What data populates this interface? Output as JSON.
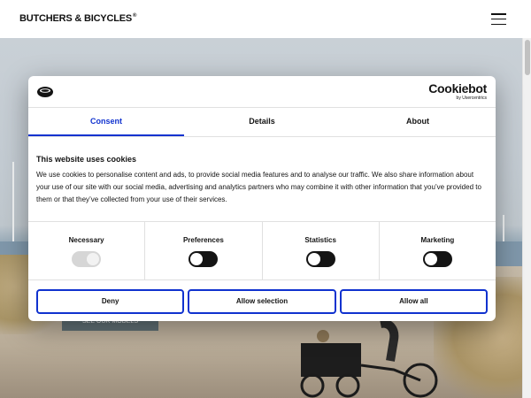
{
  "header": {
    "brand": "BUTCHERS & BICYCLES",
    "brand_mark": "®",
    "menu_icon": "hamburger-icon"
  },
  "hero": {
    "cta_label": "SEE OUR MODELS"
  },
  "cookie_dialog": {
    "logo_icon": "cookie-icon",
    "brand_name": "Cookiebot",
    "brand_sub": "by Usercentrics",
    "tabs": [
      {
        "label": "Consent",
        "active": true
      },
      {
        "label": "Details",
        "active": false
      },
      {
        "label": "About",
        "active": false
      }
    ],
    "heading": "This website uses cookies",
    "description": "We use cookies to personalise content and ads, to provide social media features and to analyse our traffic. We also share information about your use of our site with our social media, advertising and analytics partners who may combine it with other information that you’ve provided to them or that they’ve collected from your use of their services.",
    "categories": [
      {
        "label": "Necessary",
        "enabled": true,
        "locked": true
      },
      {
        "label": "Preferences",
        "enabled": false,
        "locked": false
      },
      {
        "label": "Statistics",
        "enabled": false,
        "locked": false
      },
      {
        "label": "Marketing",
        "enabled": false,
        "locked": false
      }
    ],
    "buttons": {
      "deny": "Deny",
      "allow_selection": "Allow selection",
      "allow_all": "Allow all"
    },
    "accent_color": "#1032cf"
  }
}
